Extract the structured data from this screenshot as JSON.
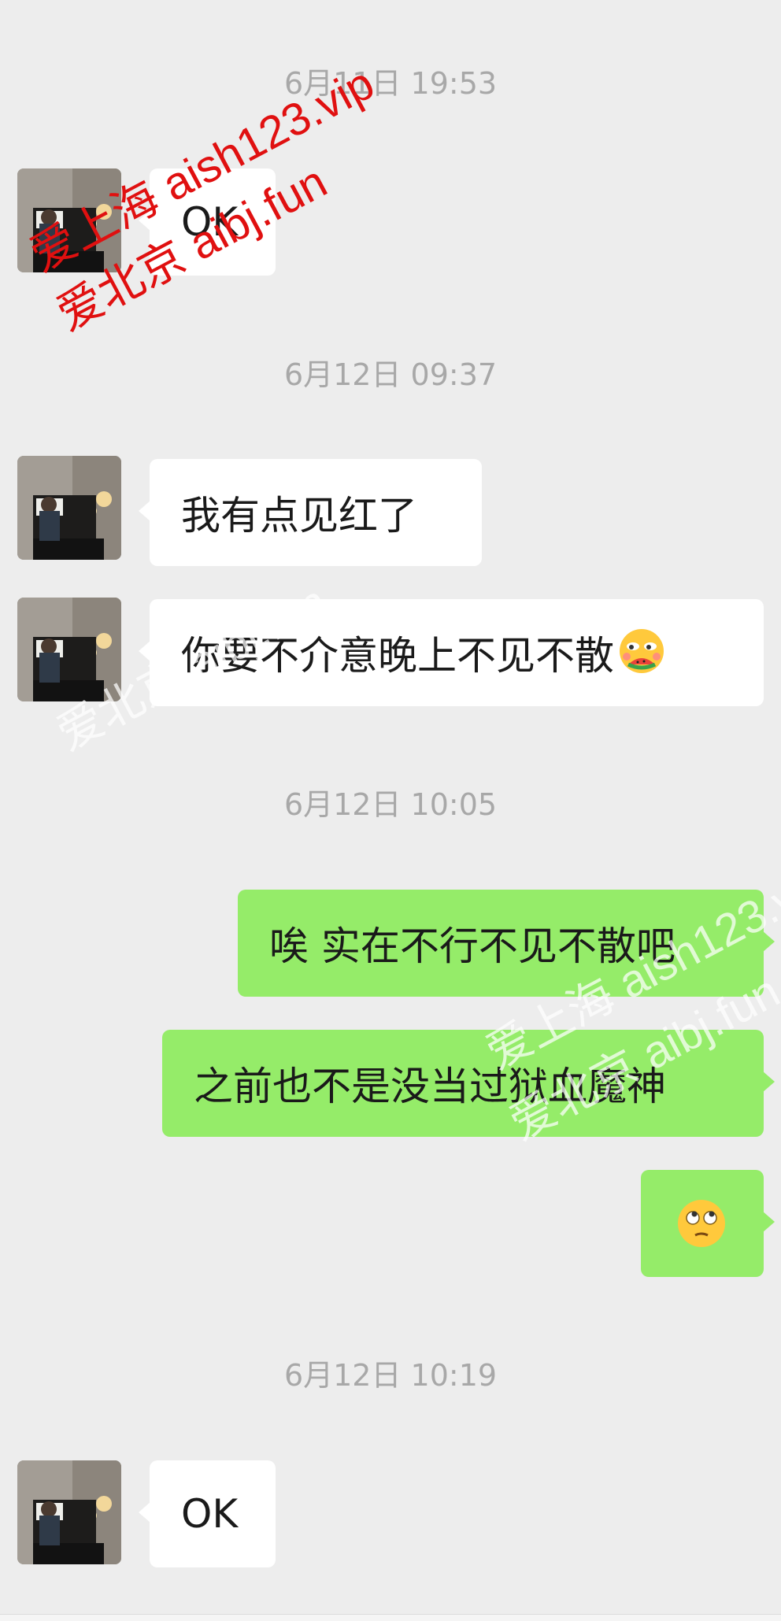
{
  "messages": [
    {
      "type": "time",
      "text": "6月11日 19:53"
    },
    {
      "type": "in",
      "text": "OK"
    },
    {
      "type": "time",
      "text": "6月12日 09:37"
    },
    {
      "type": "in",
      "text": "我有点见红了"
    },
    {
      "type": "in",
      "text": "你要不介意晚上不见不散",
      "emoji": "watermelon-face-emoji"
    },
    {
      "type": "time",
      "text": "6月12日 10:05"
    },
    {
      "type": "out",
      "text": "唉 实在不行不见不散吧"
    },
    {
      "type": "out",
      "text": "之前也不是没当过狱血魔神"
    },
    {
      "type": "out",
      "text": "",
      "emoji": "eye-roll-emoji"
    },
    {
      "type": "time",
      "text": "6月12日 10:19"
    },
    {
      "type": "in",
      "text": "OK"
    }
  ],
  "watermarks": {
    "red_line1": "爱上海 aish123.vip",
    "red_line2": "爱北京 aibj.fun"
  },
  "colors": {
    "background": "#ededed",
    "incoming_bubble": "#ffffff",
    "outgoing_bubble": "#95ec69",
    "timestamp_text": "#a8a8a8",
    "watermark_red": "#e01010"
  }
}
